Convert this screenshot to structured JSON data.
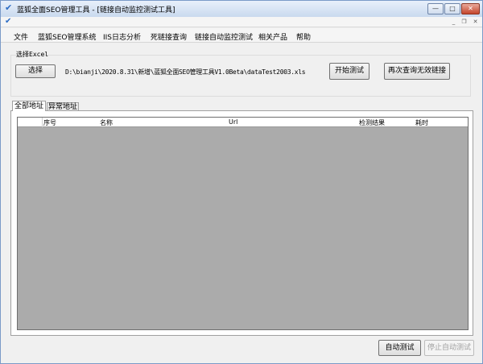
{
  "window": {
    "title": "蓝狐全面SEO管理工具 - [链接自动监控测试工具]",
    "controls": {
      "minimize": "—",
      "maximize": "□",
      "close": "✕"
    },
    "mdi_controls": {
      "minimize": "_",
      "restore": "❐",
      "close": "✕"
    }
  },
  "menu": [
    "文件",
    "蓝狐SEO管理系统",
    "IIS日志分析",
    "死链接查询",
    "链接自动监控测试",
    "相关产品",
    "帮助"
  ],
  "excel_group": {
    "label": "选择Excel",
    "select_button": "选择",
    "file_path": "D:\\bianji\\2020.8.31\\新增\\蓝狐全面SEO管理工具V1.0Beta\\dataTest2003.xls",
    "start_button": "开始测试",
    "requery_button": "再次查询无效链接"
  },
  "tabs": [
    {
      "label": "全部地址",
      "active": true
    },
    {
      "label": "异常地址",
      "active": false
    }
  ],
  "grid": {
    "columns": [
      "序号",
      "名称",
      "Url",
      "检测结果",
      "耗时"
    ]
  },
  "footer": {
    "auto_test_button": "自动测试",
    "stop_auto_test_button": "停止自动测试"
  },
  "colors": {
    "accent": "#2c6cc4",
    "grid_bg": "#ababab",
    "titlebar": "#c9d9ee"
  },
  "icons": {
    "app": "fox-icon"
  }
}
